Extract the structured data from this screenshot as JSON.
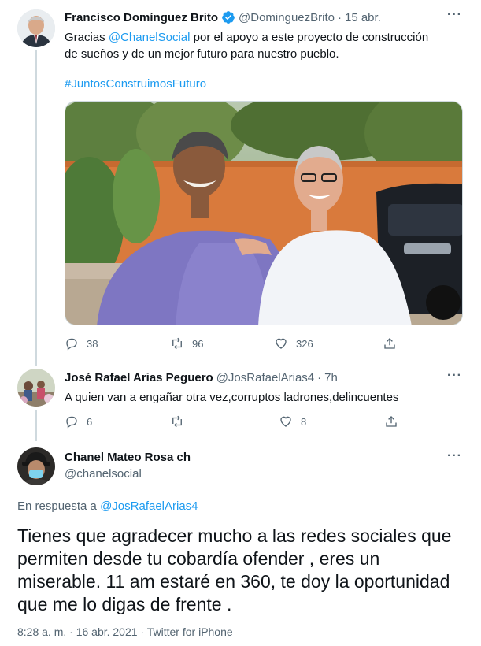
{
  "tweet1": {
    "name": "Francisco Domínguez Brito",
    "handle": "@DominguezBrito",
    "dot": "·",
    "date": "15 abr.",
    "text_prefix": "Gracias ",
    "mention": "@ChanelSocial",
    "text_suffix": " por el apoyo a este proyecto de construcción de sueños y de un mejor futuro para nuestro pueblo.",
    "hashtag": "#JuntosConstruimosFuturo",
    "replies": "38",
    "retweets": "96",
    "likes": "326",
    "verified": true
  },
  "tweet2": {
    "name": "José Rafael Arias Peguero",
    "handle": "@JosRafaelArias4",
    "dot": "·",
    "date": "7h",
    "text": "A quien van a engañar otra vez,corruptos ladrones,delincuentes",
    "replies": "6",
    "retweets": "",
    "likes": "8"
  },
  "tweet3": {
    "name": "Chanel Mateo Rosa ch",
    "handle": "@chanelsocial",
    "reply_prefix": "En respuesta a ",
    "reply_to": "@JosRafaelArias4",
    "text": "Tienes que agradecer mucho a las redes sociales que permiten desde tu cobardía ofender , eres un miserable. 11 am estaré en 360, te doy la oportunidad que me lo digas de frente .",
    "timestamp": "8:28 a. m. · 16 abr. 2021 · Twitter for iPhone"
  },
  "more_icon": "···",
  "colors": {
    "accent": "#1d9bf0",
    "secondary_text": "#536471",
    "thread_line": "#cfd9de"
  }
}
